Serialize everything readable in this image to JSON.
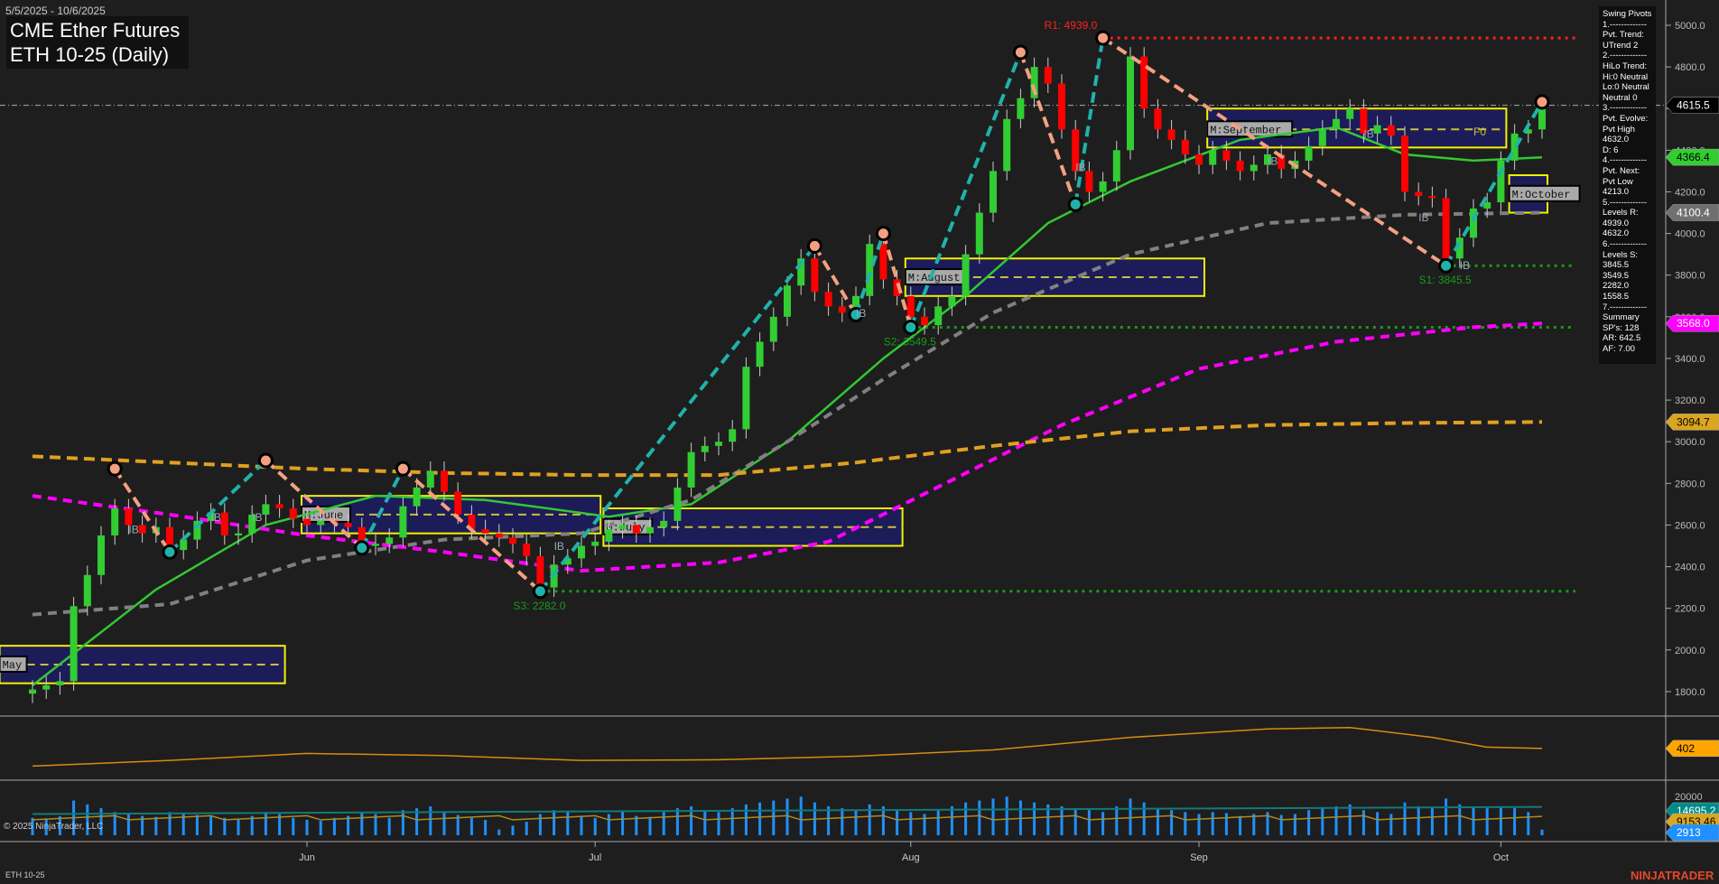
{
  "header": {
    "date_range": "5/5/2025 - 10/6/2025",
    "title": "CME Ether Futures",
    "subtitle": "ETH 10-25 (Daily)"
  },
  "info_panel": {
    "lines": [
      "Swing Pivots",
      "1.-------------",
      "Pvt. Trend:",
      "UTrend 2",
      "2.-------------",
      "HiLo Trend:",
      "Hi:0 Neutral",
      "Lo:0 Neutral",
      "Neutral 0",
      "3.-------------",
      "Pvt. Evolve:",
      "Pvt High",
      "4632.0",
      "D: 6",
      "4.-------------",
      "Pvt. Next:",
      "Pvt Low",
      "4213.0",
      "5.-------------",
      "Levels R:",
      "4939.0",
      "4632.0",
      "6.-------------",
      "Levels S:",
      "3845.5",
      "3549.5",
      "2282.0",
      "1558.5",
      "7.-------------",
      "Summary",
      "SP's: 128",
      "AR: 642.5",
      "AF: 7.00"
    ]
  },
  "footer": {
    "copyright": "© 2025 NinjaTrader, LLC",
    "symbol": "ETH 10-25",
    "brand": "NINJATRADER"
  },
  "colors": {
    "up": "#32cd32",
    "down": "#ff0000",
    "ma_fast": "#32c832",
    "ma_mid": "#808080",
    "ma_slow": "#ff00ff",
    "ma_long": "#e0a020",
    "swing_up": "#20b2aa",
    "swing_down": "#f4a080",
    "box": "#ffff00",
    "box_fill": "#1c1c5c",
    "volume": "#1e90ff"
  },
  "chart_data": {
    "type": "candlestick",
    "title": "ETH 10-25 (Daily)",
    "ylim": [
      1650,
      5120
    ],
    "y_ticks": [
      5000,
      4800,
      4600,
      4400,
      4200,
      4000,
      3800,
      3600,
      3400,
      3200,
      3000,
      2800,
      2600,
      2400,
      2200,
      2000,
      1800
    ],
    "x_ticks": [
      {
        "label": "Jun",
        "index": 20
      },
      {
        "label": "Jul",
        "index": 41
      },
      {
        "label": "Aug",
        "index": 64
      },
      {
        "label": "Sep",
        "index": 85
      },
      {
        "label": "Oct",
        "index": 107
      }
    ],
    "closes": [
      1810,
      1830,
      1850,
      2210,
      2360,
      2550,
      2680,
      2600,
      2560,
      2590,
      2480,
      2530,
      2620,
      2660,
      2550,
      2560,
      2650,
      2700,
      2680,
      2630,
      2600,
      2620,
      2610,
      2590,
      2500,
      2510,
      2540,
      2690,
      2780,
      2860,
      2760,
      2650,
      2580,
      2560,
      2540,
      2510,
      2450,
      2300,
      2410,
      2440,
      2500,
      2520,
      2580,
      2600,
      2560,
      2590,
      2620,
      2780,
      2950,
      2980,
      3000,
      3060,
      3360,
      3480,
      3600,
      3750,
      3880,
      3720,
      3650,
      3620,
      3700,
      3950,
      3780,
      3700,
      3600,
      3560,
      3650,
      3700,
      3900,
      4100,
      4300,
      4550,
      4650,
      4800,
      4720,
      4500,
      4300,
      4200,
      4250,
      4400,
      4850,
      4600,
      4500,
      4450,
      4380,
      4330,
      4400,
      4350,
      4300,
      4330,
      4380,
      4310,
      4350,
      4420,
      4500,
      4550,
      4600,
      4480,
      4520,
      4470,
      4200,
      4180,
      4170,
      3880,
      3980,
      4120,
      4150,
      4350,
      4480,
      4500,
      4615
    ],
    "opens_start": 1790,
    "price_labels": [
      {
        "value": "4615.5",
        "bg": "#000000",
        "fg": "#ffffff",
        "price": 4615.5
      },
      {
        "value": "4366.4",
        "bg": "#32cd32",
        "fg": "#000000",
        "price": 4366.4
      },
      {
        "value": "4100.4",
        "bg": "#707070",
        "fg": "#ffffff",
        "price": 4100.4
      },
      {
        "value": "3568.0",
        "bg": "#ff00ff",
        "fg": "#ffffff",
        "price": 3568.0
      },
      {
        "value": "3094.7",
        "bg": "#daa520",
        "fg": "#000000",
        "price": 3094.7
      }
    ],
    "current_price": 4615.5,
    "moving_averages": [
      {
        "name": "fast",
        "color": "#32c832",
        "dash": "",
        "points": [
          [
            0,
            1830
          ],
          [
            9,
            2290
          ],
          [
            17,
            2600
          ],
          [
            25,
            2740
          ],
          [
            33,
            2720
          ],
          [
            42,
            2640
          ],
          [
            48,
            2700
          ],
          [
            55,
            3000
          ],
          [
            62,
            3400
          ],
          [
            68,
            3700
          ],
          [
            74,
            4050
          ],
          [
            80,
            4250
          ],
          [
            88,
            4450
          ],
          [
            95,
            4510
          ],
          [
            100,
            4380
          ],
          [
            105,
            4350
          ],
          [
            110,
            4366
          ]
        ]
      },
      {
        "name": "mid",
        "color": "#808080",
        "dash": "10,7",
        "points": [
          [
            0,
            2170
          ],
          [
            10,
            2220
          ],
          [
            20,
            2430
          ],
          [
            30,
            2530
          ],
          [
            40,
            2560
          ],
          [
            48,
            2720
          ],
          [
            55,
            3000
          ],
          [
            62,
            3300
          ],
          [
            70,
            3620
          ],
          [
            80,
            3900
          ],
          [
            90,
            4050
          ],
          [
            100,
            4090
          ],
          [
            110,
            4100
          ]
        ]
      },
      {
        "name": "slow",
        "color": "#ff00ff",
        "dash": "10,7",
        "points": [
          [
            0,
            2740
          ],
          [
            10,
            2650
          ],
          [
            20,
            2550
          ],
          [
            30,
            2470
          ],
          [
            40,
            2380
          ],
          [
            50,
            2420
          ],
          [
            58,
            2520
          ],
          [
            65,
            2750
          ],
          [
            75,
            3080
          ],
          [
            85,
            3350
          ],
          [
            95,
            3480
          ],
          [
            105,
            3550
          ],
          [
            110,
            3568
          ]
        ]
      },
      {
        "name": "long",
        "color": "#e0a020",
        "dash": "12,7",
        "points": [
          [
            0,
            2930
          ],
          [
            10,
            2900
          ],
          [
            20,
            2870
          ],
          [
            30,
            2850
          ],
          [
            40,
            2840
          ],
          [
            50,
            2840
          ],
          [
            60,
            2900
          ],
          [
            70,
            2980
          ],
          [
            80,
            3050
          ],
          [
            90,
            3080
          ],
          [
            100,
            3090
          ],
          [
            110,
            3095
          ]
        ]
      }
    ],
    "swing_pivots": [
      [
        6,
        2870
      ],
      [
        10,
        2470
      ],
      [
        17,
        2910
      ],
      [
        24,
        2490
      ],
      [
        27,
        2870
      ],
      [
        37,
        2282
      ],
      [
        57,
        3940
      ],
      [
        60,
        3610
      ],
      [
        62,
        4000
      ],
      [
        64,
        3549.5
      ],
      [
        72,
        4870
      ],
      [
        76,
        4140
      ],
      [
        78,
        4939
      ],
      [
        103,
        3845.5
      ],
      [
        110,
        4632
      ]
    ],
    "levels": [
      {
        "label": "R1: 4939.0",
        "price": 4939,
        "start": 78,
        "color": "#ff2020"
      },
      {
        "label": "S1: 3845.5",
        "price": 3845.5,
        "start": 103,
        "color": "#1a9a1a"
      },
      {
        "label": "S2: 3549.5",
        "price": 3549.5,
        "start": 64,
        "color": "#1a9a1a"
      },
      {
        "label": "S3: 2282.0",
        "price": 2282,
        "start": 37,
        "color": "#1a9a1a"
      }
    ],
    "monthly_boxes": [
      {
        "label": "May",
        "start": -2,
        "end": 18,
        "top": 2020,
        "bottom": 1840,
        "mid": 1930
      },
      {
        "label": "M:June",
        "start": 20,
        "end": 41,
        "top": 2740,
        "bottom": 2560,
        "mid": 2650
      },
      {
        "label": "M:July",
        "start": 42,
        "end": 63,
        "top": 2680,
        "bottom": 2500,
        "mid": 2590
      },
      {
        "label": "M:August",
        "start": 64,
        "end": 85,
        "top": 3880,
        "bottom": 3700,
        "mid": 3790
      },
      {
        "label": "M:September",
        "start": 86,
        "end": 107,
        "top": 4600,
        "bottom": 4413,
        "mid": 4500
      },
      {
        "label": "M:October",
        "start": 108,
        "end": 110,
        "top": 4280,
        "bottom": 4100,
        "mid": 4190
      }
    ],
    "annotations": [
      {
        "text": "IB",
        "index": 7,
        "price": 2560
      },
      {
        "text": "IB",
        "index": 13,
        "price": 2620
      },
      {
        "text": "IB",
        "index": 16,
        "price": 2620
      },
      {
        "text": "IB",
        "index": 38,
        "price": 2480
      },
      {
        "text": "IB",
        "index": 60,
        "price": 3600
      },
      {
        "text": "IB",
        "index": 76,
        "price": 4300
      },
      {
        "text": "IB",
        "index": 90,
        "price": 4330
      },
      {
        "text": "IB",
        "index": 97,
        "price": 4460
      },
      {
        "text": "IB",
        "index": 101,
        "price": 4060
      },
      {
        "text": "IB",
        "index": 104,
        "price": 3830
      },
      {
        "text": "F0",
        "index": 105,
        "price": 4470
      }
    ],
    "indicator": {
      "label": "402",
      "ylim": [
        0,
        800
      ],
      "points": [
        [
          0,
          150
        ],
        [
          10,
          230
        ],
        [
          20,
          330
        ],
        [
          30,
          300
        ],
        [
          40,
          230
        ],
        [
          50,
          240
        ],
        [
          60,
          290
        ],
        [
          70,
          380
        ],
        [
          80,
          560
        ],
        [
          90,
          680
        ],
        [
          96,
          700
        ],
        [
          102,
          560
        ],
        [
          106,
          420
        ],
        [
          110,
          402
        ]
      ]
    },
    "volume": {
      "ylim": [
        0,
        22000
      ],
      "ticks": [
        "20000",
        "0"
      ],
      "labels": [
        {
          "value": "14695.2",
          "bg": "#008b8b"
        },
        {
          "value": "9153.46",
          "bg": "#daa520"
        },
        {
          "value": "2913",
          "bg": "#1e90ff"
        }
      ],
      "values": [
        9000,
        8500,
        9800,
        18000,
        16000,
        14000,
        12000,
        11000,
        10000,
        9500,
        12000,
        11000,
        10500,
        9800,
        9000,
        8500,
        10000,
        12000,
        11000,
        9000,
        8000,
        7500,
        9000,
        10000,
        12000,
        11000,
        9000,
        13000,
        14000,
        15000,
        12000,
        10500,
        9000,
        8000,
        3000,
        5000,
        7000,
        11000,
        13000,
        12000,
        10000,
        9000,
        11000,
        12000,
        10000,
        9500,
        12000,
        14000,
        15000,
        13000,
        12000,
        14000,
        16000,
        17000,
        18000,
        19000,
        20000,
        17000,
        15000,
        14000,
        13000,
        16000,
        15000,
        13000,
        12000,
        11000,
        13000,
        15000,
        17000,
        18000,
        19000,
        20000,
        18000,
        17000,
        16000,
        15000,
        14000,
        13000,
        12000,
        15000,
        19000,
        17000,
        14000,
        13000,
        12000,
        11000,
        12000,
        11500,
        10000,
        11000,
        12000,
        10500,
        11000,
        13000,
        14000,
        15000,
        16000,
        13000,
        12000,
        11000,
        17000,
        15000,
        14000,
        19000,
        16000,
        15000,
        14000,
        15000,
        14000,
        12000,
        2913
      ]
    }
  }
}
